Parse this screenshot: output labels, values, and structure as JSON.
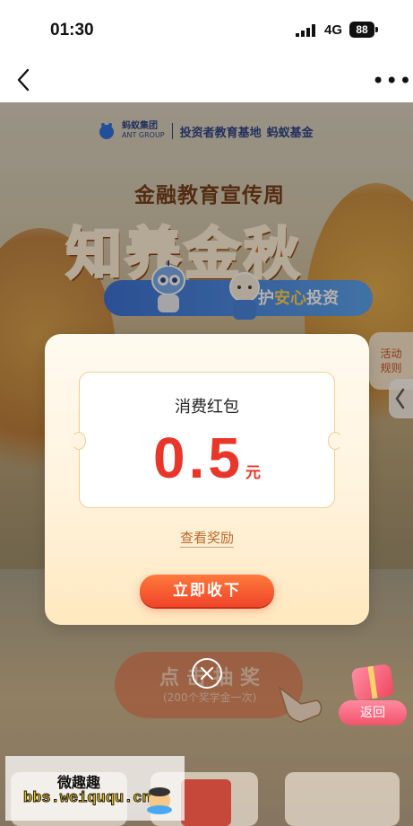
{
  "status_bar": {
    "time": "01:30",
    "network": "4G",
    "battery": "88"
  },
  "banner": {
    "brand_cn": "蚂蚁集团",
    "brand_en": "ANT GROUP",
    "partner_text": "投资者教育基地",
    "fund_text": "蚂蚁基金",
    "event_subtitle": "金融教育宣传周",
    "event_title": "知养金秋",
    "slogan_prefix": "护",
    "slogan_highlight": "安心",
    "slogan_suffix": "投资",
    "rules_label_line1": "活动",
    "rules_label_line2": "规则"
  },
  "modal": {
    "coupon_title": "消费红包",
    "amount": "0.5",
    "unit": "元",
    "view_reward_link": "查看奖励",
    "claim_button": "立即收下"
  },
  "background": {
    "draw_button_label": "点击抽奖",
    "draw_button_sub": "(200个奖学金一次)",
    "back_label": "返回"
  },
  "watermark": {
    "site_cn": "微趣趣",
    "url": "bbs.weiququ.cn"
  },
  "colors": {
    "accent_red": "#e8362a",
    "claim_button": "#f0442a",
    "brand_blue": "#1f3b84"
  }
}
